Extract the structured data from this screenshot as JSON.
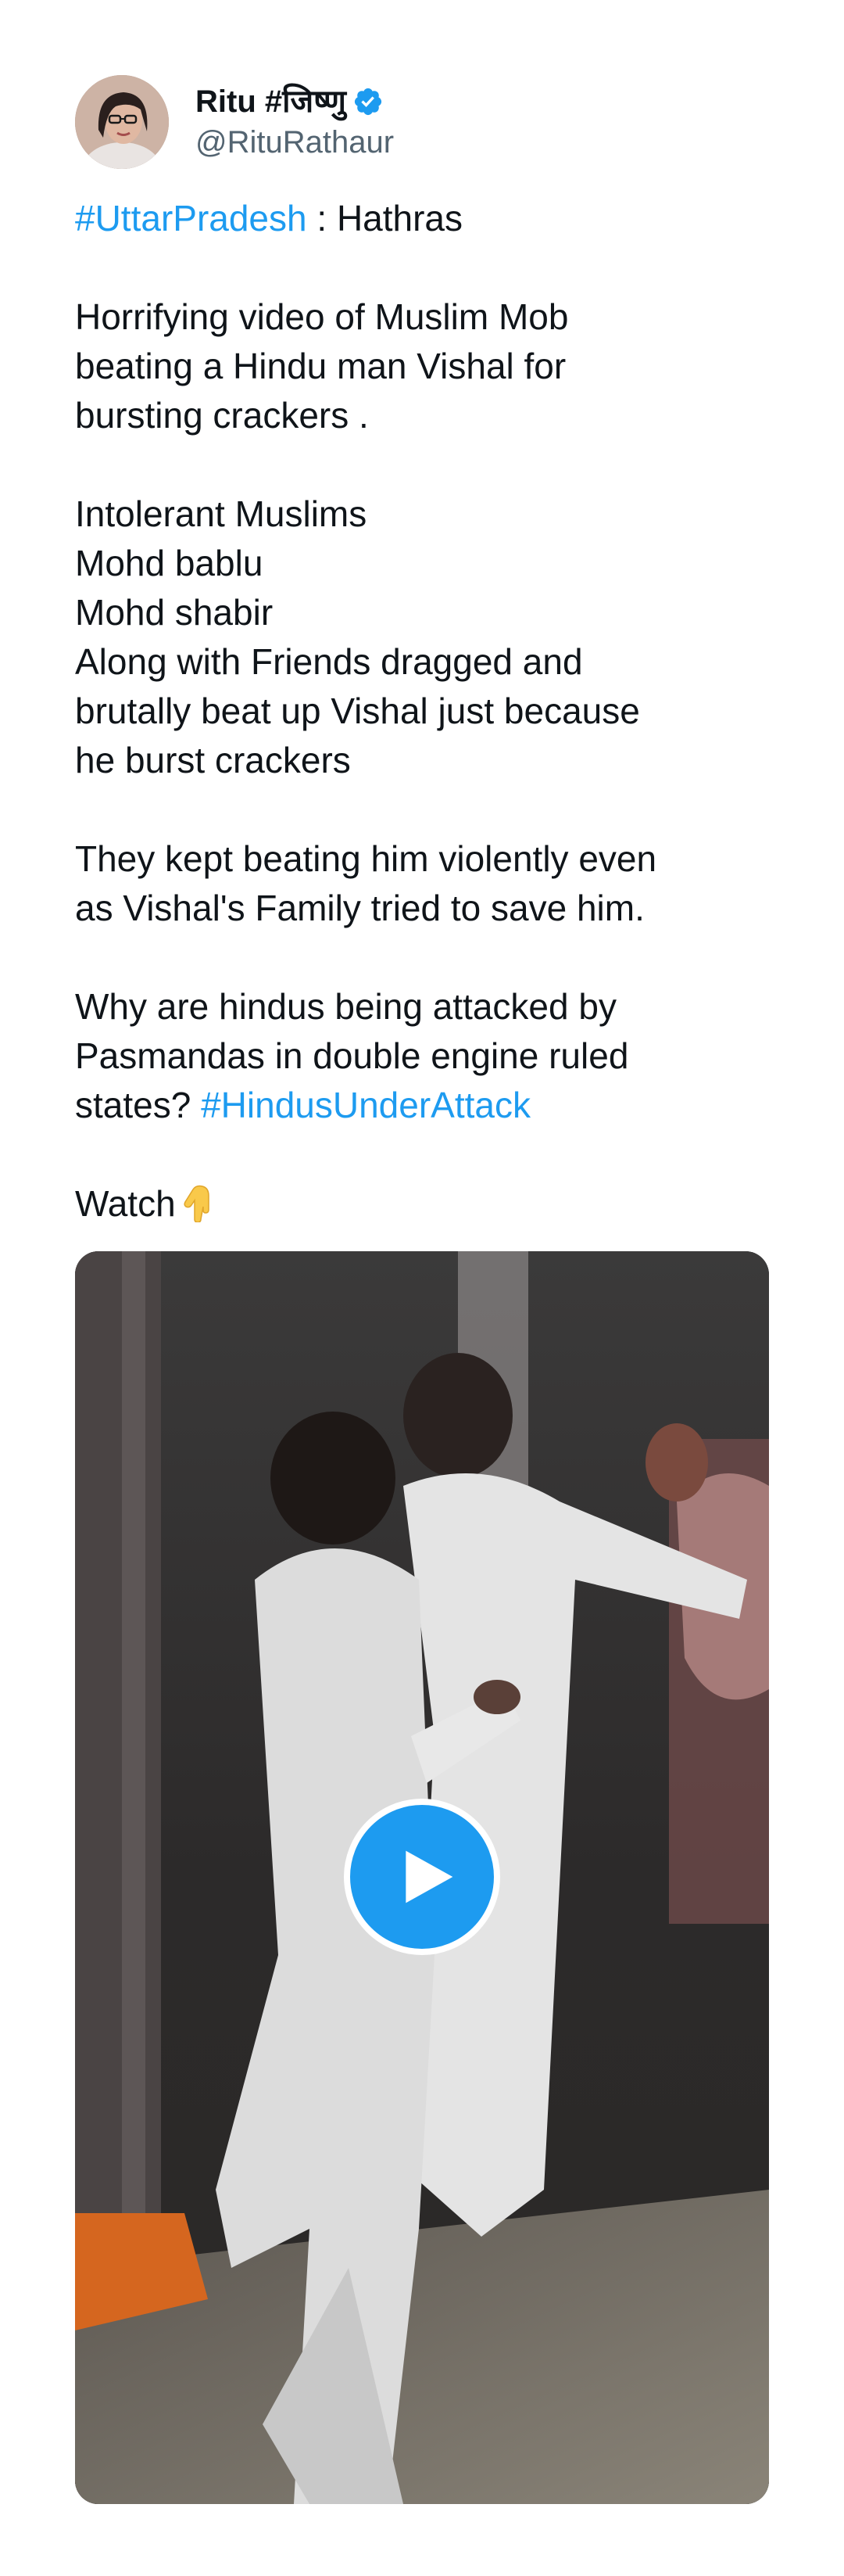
{
  "author": {
    "display_name": "Ritu #जिष्णु",
    "handle": "@RituRathaur",
    "verified_icon": "verified-badge-icon",
    "verified_color": "#1d9bf0"
  },
  "tweet": {
    "hashtag_location": "#UttarPradesh",
    "location_suffix": " : Hathras",
    "paragraph_1": [
      "Horrifying video of Muslim Mob",
      "beating a Hindu man Vishal for",
      "bursting crackers ."
    ],
    "paragraph_2": [
      "Intolerant Muslims",
      "Mohd bablu",
      "Mohd shabir",
      "Along with Friends dragged and",
      "brutally beat up Vishal just because",
      "he burst crackers"
    ],
    "paragraph_3": [
      "They kept beating him violently even",
      "as Vishal's Family tried to save him."
    ],
    "paragraph_4_lines": [
      "Why are hindus being attacked by",
      "Pasmandas in double engine ruled"
    ],
    "paragraph_4_last_prefix": "states? ",
    "hashtag_attack": "#HindusUnderAttack",
    "watch_label": "Watch",
    "watch_emoji": "pointing-down-emoji"
  },
  "video": {
    "play_icon": "play-icon",
    "play_color": "#1d9bf0"
  },
  "colors": {
    "link": "#1d9bf0",
    "text": "#0f1419",
    "muted": "#536471"
  }
}
